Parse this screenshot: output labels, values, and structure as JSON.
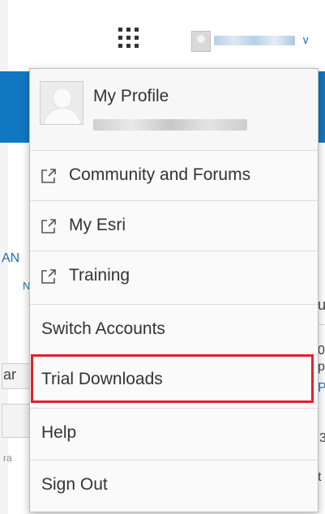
{
  "header": {
    "apps_icon": "grid-icon"
  },
  "background_fragments": {
    "left_1": "AN",
    "left_2": "N",
    "left_3": "ar",
    "left_4": "ra",
    "right_1": "ul",
    "right_2": "0",
    "right_3": "pi",
    "right_4": "P",
    "right_5": "3",
    "right_6": "t"
  },
  "menu": {
    "profile": {
      "title": "My Profile"
    },
    "items": [
      {
        "label": "Community and Forums",
        "icon": "external-link-icon"
      },
      {
        "label": "My Esri",
        "icon": "external-link-icon"
      },
      {
        "label": "Training",
        "icon": "external-link-icon"
      },
      {
        "label": "Switch Accounts"
      },
      {
        "label": "Trial Downloads",
        "highlighted": true
      },
      {
        "label": "Help"
      },
      {
        "label": "Sign Out"
      }
    ],
    "highlight_color": "#e3202b"
  }
}
